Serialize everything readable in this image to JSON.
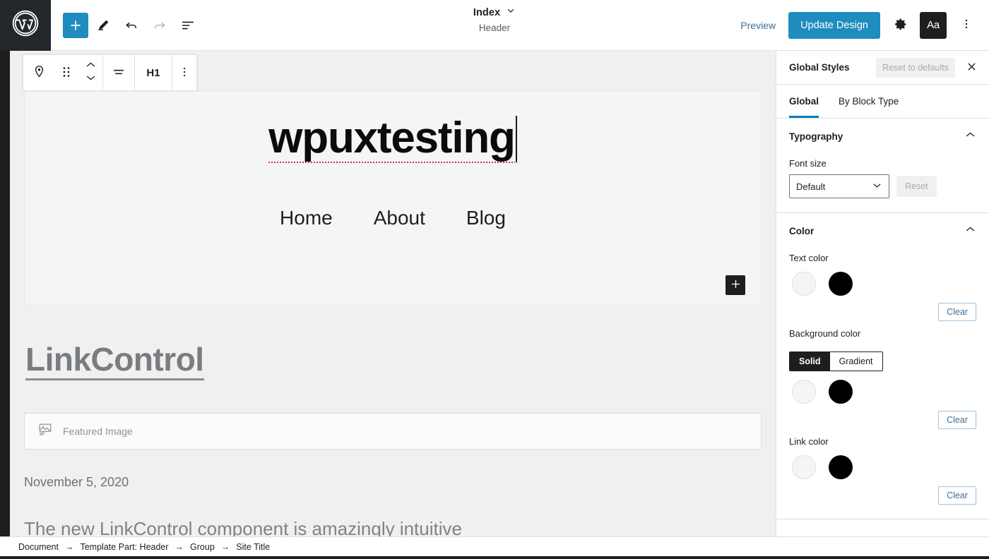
{
  "topbar": {
    "logo_icon": "wordpress-logo-icon",
    "add_block_icon": "plus-icon",
    "tools_icon": "pencil-icon",
    "undo_icon": "undo-arrow-icon",
    "redo_icon": "redo-arrow-icon",
    "list_view_icon": "list-view-icon",
    "document_title": "Index",
    "document_title_chevron": "chevron-down-icon",
    "document_subtitle": "Header",
    "preview_label": "Preview",
    "update_label": "Update Design",
    "settings_icon": "gear-icon",
    "styles_label": "Aa",
    "more_icon": "ellipsis-vertical-icon",
    "accent_color": "#1e8cbe"
  },
  "block_toolbar": {
    "block_type_icon": "site-title-pin-icon",
    "drag_icon": "drag-handle-icon",
    "move_up_icon": "chevron-up-icon",
    "move_down_icon": "chevron-down-icon",
    "align_icon": "align-text-icon",
    "heading_level": "H1",
    "options_icon": "ellipsis-vertical-icon"
  },
  "canvas": {
    "site_title": "wpuxtesting",
    "nav_links": [
      {
        "label": "Home"
      },
      {
        "label": "About"
      },
      {
        "label": "Blog"
      }
    ],
    "appender_icon": "plus-icon",
    "post_title": "LinkControl",
    "featured_image_icon": "image-placeholder-icon",
    "featured_image_label": "Featured Image",
    "post_date": "November 5, 2020",
    "post_excerpt": "The new LinkControl component is amazingly intuitive",
    "spellcheck_underline_color": "#d0304b",
    "block_background": "#f4f5f5"
  },
  "sidebar": {
    "title": "Global Styles",
    "reset_defaults_label": "Reset to defaults",
    "close_icon": "close-icon",
    "tabs": [
      {
        "label": "Global",
        "active": true
      },
      {
        "label": "By Block Type",
        "active": false
      }
    ],
    "active_tab_color": "#007cba",
    "typography": {
      "title": "Typography",
      "collapse_icon": "chevron-up-icon",
      "font_size_label": "Font size",
      "font_size_value": "Default",
      "font_size_chevron": "chevron-down-icon",
      "reset_label": "Reset"
    },
    "color": {
      "title": "Color",
      "collapse_icon": "chevron-up-icon",
      "text_color_label": "Text color",
      "text_clear_label": "Clear",
      "background_color_label": "Background color",
      "background_tabs": [
        {
          "label": "Solid",
          "active": true
        },
        {
          "label": "Gradient",
          "active": false
        }
      ],
      "background_clear_label": "Clear",
      "link_color_label": "Link color",
      "link_clear_label": "Clear",
      "swatch_light": "#f5f5f5",
      "swatch_dark": "#000000"
    }
  },
  "breadcrumb": {
    "separator": "→",
    "items": [
      {
        "label": "Document"
      },
      {
        "label": "Template Part: Header"
      },
      {
        "label": "Group"
      },
      {
        "label": "Site Title"
      }
    ]
  }
}
